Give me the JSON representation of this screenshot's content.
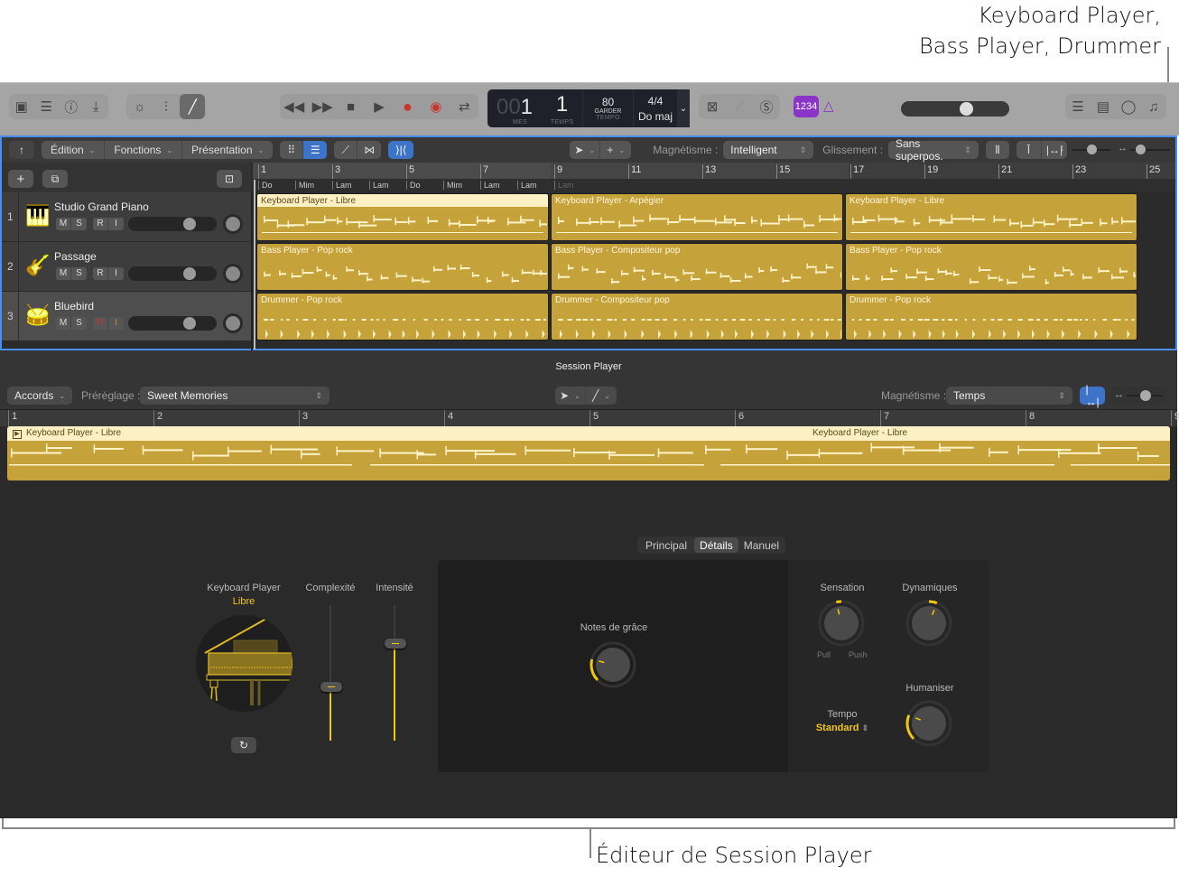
{
  "callouts": {
    "top_line1": "Keyboard Player,",
    "top_line2": "Bass Player, Drummer",
    "bottom": "Éditeur de Session Player"
  },
  "control_bar": {
    "left_icons": [
      "library-icon",
      "toggles-icon",
      "help-icon",
      "download-icon"
    ],
    "view_icons": [
      "brightness-icon",
      "mixer-icon",
      "pencil-icon"
    ],
    "transport": [
      "rewind-icon",
      "fast-forward-icon",
      "stop-icon",
      "play-icon",
      "record-icon",
      "capture-record-icon",
      "cycle-icon"
    ],
    "lcd": {
      "bar_dim": "00",
      "bar": "1",
      "beat": "1",
      "bar_label": "MES",
      "beat_label": "TEMPS",
      "tempo": "80",
      "tempo_mode": "GARDER",
      "tempo_label": "TEMPO",
      "signature": "4/4",
      "key": "Do maj"
    },
    "mode_icons": [
      "replace-icon",
      "tuner-icon",
      "solo-icon"
    ],
    "count_in": "1234",
    "metronome_icon": "metronome-icon",
    "master_volume": 0.62,
    "right_icons": [
      "list-icon",
      "notepad-icon",
      "loop-browser-icon",
      "media-browser-icon"
    ]
  },
  "track_toolbar": {
    "menus": [
      "Édition",
      "Fonctions",
      "Présentation"
    ],
    "snap_label": "Magnétisme :",
    "snap_value": "Intelligent",
    "drag_label": "Glissement :",
    "drag_value": "Sans superpos."
  },
  "ruler": {
    "bars": [
      "1",
      "3",
      "5",
      "7",
      "9",
      "11",
      "13",
      "15",
      "17",
      "19",
      "21",
      "23",
      "25"
    ],
    "chords": [
      "Do",
      "Mim",
      "Lam",
      "Lam",
      "Do",
      "Mim",
      "Lam",
      "Lam",
      "Lam"
    ]
  },
  "tracks": [
    {
      "num": "1",
      "name": "Studio Grand Piano",
      "icon": "piano-icon",
      "volume": 0.68,
      "regions": [
        {
          "label": "Keyboard Player - Libre",
          "selected": true
        },
        {
          "label": "Keyboard Player - Arpégier",
          "selected": false
        },
        {
          "label": "Keyboard Player - Libre",
          "selected": false
        }
      ]
    },
    {
      "num": "2",
      "name": "Passage",
      "icon": "bass-guitar-icon",
      "volume": 0.68,
      "regions": [
        {
          "label": "Bass Player - Pop rock",
          "selected": false
        },
        {
          "label": "Bass Player - Compositeur pop",
          "selected": false
        },
        {
          "label": "Bass Player - Pop rock",
          "selected": false
        }
      ]
    },
    {
      "num": "3",
      "name": "Bluebird",
      "icon": "drum-kit-icon",
      "volume": 0.68,
      "regions": [
        {
          "label": "Drummer - Pop rock",
          "selected": false
        },
        {
          "label": "Drummer - Compositeur pop",
          "selected": false
        },
        {
          "label": "Drummer - Pop rock",
          "selected": false
        }
      ]
    }
  ],
  "track_buttons": {
    "mute": "M",
    "solo": "S",
    "record": "R",
    "input": "I"
  },
  "session_player": {
    "title": "Session Player",
    "mode": "Accords",
    "preset_label": "Préréglage :",
    "preset_value": "Sweet Memories",
    "snap_label": "Magnétisme :",
    "snap_value": "Temps",
    "ruler": [
      "1",
      "2",
      "3",
      "4",
      "5",
      "6",
      "7",
      "8",
      "9"
    ],
    "region_label": "Keyboard Player - Libre",
    "tabs": [
      "Principal",
      "Détails",
      "Manuel"
    ],
    "active_tab": "Détails",
    "player_name": "Keyboard Player",
    "player_style": "Libre",
    "complexity_label": "Complexité",
    "complexity": 0.4,
    "intensity_label": "Intensité",
    "intensity": 0.72,
    "grace_notes_label": "Notes de grâce",
    "grace_notes": 0.22,
    "feel_label": "Sensation",
    "feel_pull": "Pull",
    "feel_push": "Push",
    "feel": 0.45,
    "dynamics_label": "Dynamiques",
    "dynamics": 0.58,
    "humanize_label": "Humaniser",
    "humanize": 0.25,
    "tempo_label": "Tempo",
    "tempo_value": "Standard"
  }
}
